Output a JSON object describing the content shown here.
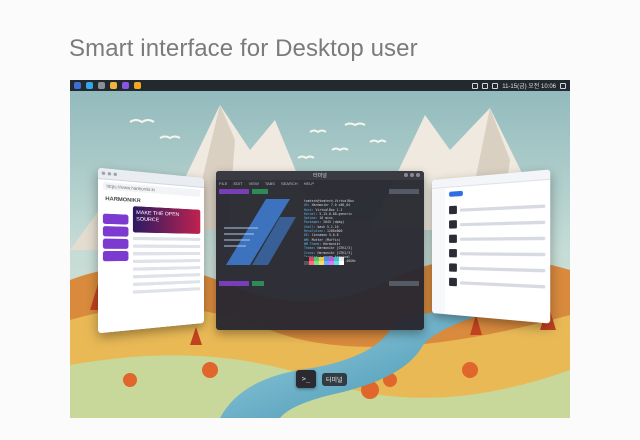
{
  "headline": "Smart interface for Desktop user",
  "panel": {
    "clock": "11-15(금) 오전 10:06",
    "apps": [
      "#3b6fd6",
      "#35a7e8",
      "#8a8f99",
      "#f2b53c",
      "#8a55e0",
      "#f5a623"
    ]
  },
  "terminal": {
    "title": "터미널",
    "menu": [
      "FILE",
      "EDIT",
      "VIEW",
      "TABS",
      "SEARCH",
      "HELP"
    ],
    "user_host": "tomtech@tomtech-VirtualBox",
    "info": [
      {
        "k": "OS",
        "v": "Harmonikr 7.0 x86_64"
      },
      {
        "k": "Host",
        "v": "VirtualBox 1.2"
      },
      {
        "k": "Kernel",
        "v": "5.15.0-88-generic"
      },
      {
        "k": "Uptime",
        "v": "10 mins"
      },
      {
        "k": "Packages",
        "v": "2045 (dpkg)"
      },
      {
        "k": "Shell",
        "v": "bash 5.1.16"
      },
      {
        "k": "Resolution",
        "v": "1280x800"
      },
      {
        "k": "DE",
        "v": "Cinnamon 5.6.8"
      },
      {
        "k": "WM",
        "v": "Mutter (Muffin)"
      },
      {
        "k": "WM Theme",
        "v": "Harmonikr"
      },
      {
        "k": "Theme",
        "v": "Harmonikr [GTK2/3]"
      },
      {
        "k": "Icons",
        "v": "Harmonikr [GTK2/3]"
      },
      {
        "k": "Terminal",
        "v": "gnome-terminal"
      },
      {
        "k": "CPU",
        "v": "Intel i5 (4) @ 2.40GHz"
      },
      {
        "k": "GPU",
        "v": "VMware SVGA II Adapter"
      },
      {
        "k": "Memory",
        "v": "1.2GiB / 3.8GiB"
      }
    ],
    "swatches": [
      "#2a2a2a",
      "#e0435a",
      "#58c06b",
      "#e6c84b",
      "#4a8fe6",
      "#b25ad7",
      "#3fc1c9",
      "#e8e8e8",
      "#555555",
      "#ff6a7f",
      "#7fe08c",
      "#f5dd6b",
      "#6fa9ff",
      "#cf7ff0",
      "#66e0e8",
      "#ffffff"
    ]
  },
  "dock": {
    "terminal_glyph": ">_",
    "label": "터미널"
  },
  "browser": {
    "url": "https://www.harmonikr.kr",
    "logo": "HARMONIKR",
    "banner": "MAKE THE OPEN SOURCE"
  }
}
